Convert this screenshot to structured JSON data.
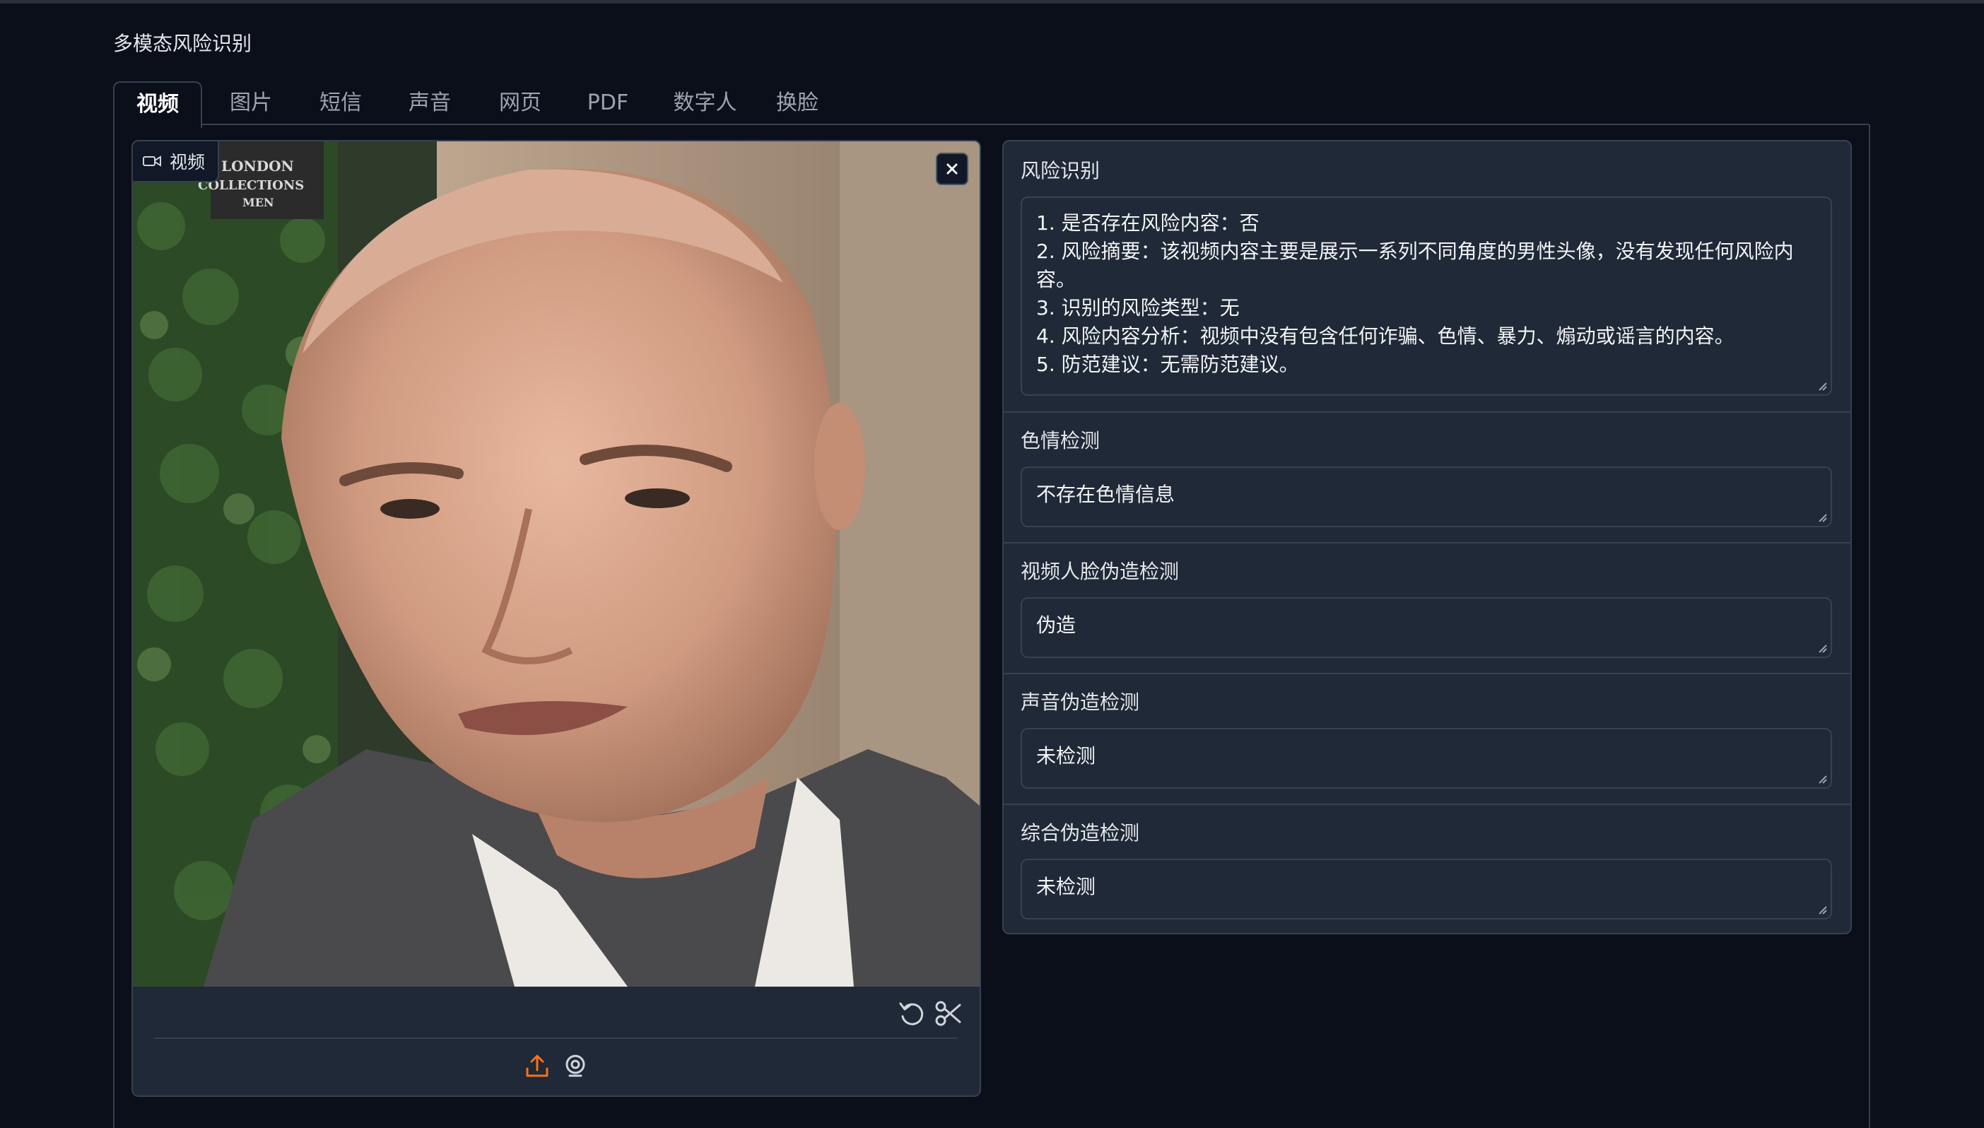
{
  "app": {
    "title": "多模态风险识别"
  },
  "tabs": [
    {
      "label": "视频",
      "active": true
    },
    {
      "label": "图片",
      "active": false
    },
    {
      "label": "短信",
      "active": false
    },
    {
      "label": "声音",
      "active": false
    },
    {
      "label": "网页",
      "active": false
    },
    {
      "label": "PDF",
      "active": false
    },
    {
      "label": "数字人",
      "active": false
    },
    {
      "label": "换脸",
      "active": false
    }
  ],
  "video": {
    "label": "视频",
    "watermark": [
      "LONDON",
      "COLLECTIONS",
      "MEN"
    ]
  },
  "results": {
    "risk": {
      "label": "风险识别",
      "lines": [
        "1. 是否存在风险内容：否",
        "2. 风险摘要：该视频内容主要是展示一系列不同角度的男性头像，没有发现任何风险内容。",
        "3. 识别的风险类型：无",
        "4. 风险内容分析：视频中没有包含任何诈骗、色情、暴力、煽动或谣言的内容。",
        "5. 防范建议：无需防范建议。"
      ]
    },
    "porn": {
      "label": "色情检测",
      "value": "不存在色情信息"
    },
    "face_forgery": {
      "label": "视频人脸伪造检测",
      "value": "伪造"
    },
    "voice_forgery": {
      "label": "声音伪造检测",
      "value": "未检测"
    },
    "overall_forgery": {
      "label": "综合伪造检测",
      "value": "未检测"
    }
  },
  "colors": {
    "background": "#0b0f19",
    "panel": "#1f2937",
    "border": "#374151",
    "upload_icon": "#f97316"
  },
  "icons": [
    "video-camera-icon",
    "close-icon",
    "undo-icon",
    "scissors-icon",
    "upload-icon",
    "webcam-icon"
  ]
}
